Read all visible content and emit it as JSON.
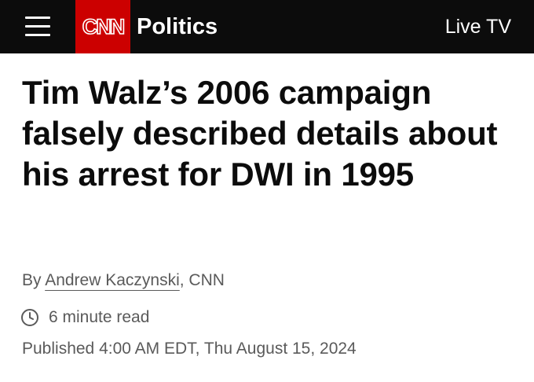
{
  "header": {
    "logo_text": "CNN",
    "section": "Politics",
    "live_tv_label": "Live TV"
  },
  "article": {
    "headline": "Tim Walz’s 2006 campaign falsely described details about his arrest for DWI in 1995",
    "byline_prefix": "By ",
    "author": "Andrew Kaczynski",
    "byline_suffix": ", CNN",
    "read_time": "6 minute read",
    "published": "Published 4:00 AM EDT, Thu August 15, 2024"
  },
  "colors": {
    "topbar": "#0c0c0c",
    "brand_red": "#cc0000",
    "meta_text": "#5a5a5a"
  },
  "icons": {
    "menu": "hamburger-menu-icon",
    "clock": "clock-icon"
  }
}
